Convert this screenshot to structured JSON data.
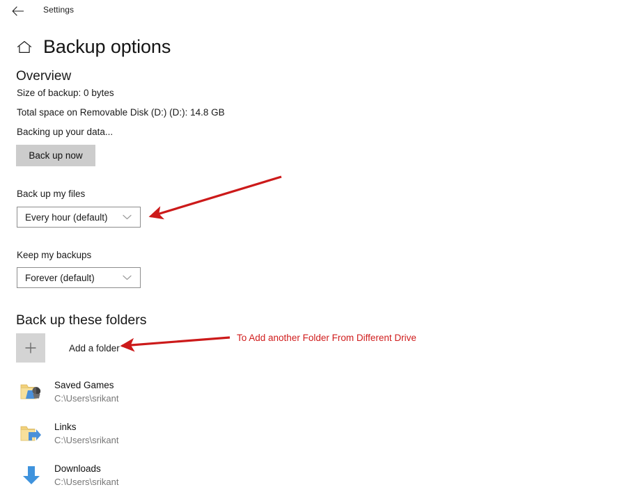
{
  "titlebar": {
    "back_icon": "back-arrow-icon",
    "app_label": "Settings"
  },
  "header": {
    "home_icon": "home-icon",
    "title": "Backup options"
  },
  "overview": {
    "heading": "Overview",
    "size_of_backup": "Size of backup: 0 bytes",
    "total_space": "Total space on Removable Disk (D:) (D:): 14.8 GB",
    "status": "Backing up your data...",
    "backup_now_label": "Back up now",
    "button_color": "#cccccc"
  },
  "settings": {
    "backup_files": {
      "label": "Back up my files",
      "selected": "Every hour (default)",
      "chevron_icon": "chevron-down-icon"
    },
    "keep_backups": {
      "label": "Keep my backups",
      "selected": "Forever (default)",
      "chevron_icon": "chevron-down-icon"
    }
  },
  "folders": {
    "heading": "Back up these folders",
    "add_folder": {
      "label": "Add a folder",
      "icon": "plus-icon",
      "tile_color": "#d4d4d4"
    },
    "items": [
      {
        "name": "Saved Games",
        "path": "C:\\Users\\srikant",
        "icon": "saved-games-folder-icon"
      },
      {
        "name": "Links",
        "path": "C:\\Users\\srikant",
        "icon": "links-shortcut-folder-icon"
      },
      {
        "name": "Downloads",
        "path": "C:\\Users\\srikant",
        "icon": "downloads-arrow-icon"
      }
    ]
  },
  "annotations": {
    "accent_color": "#d01c1c",
    "add_folder_note": "To Add another Folder From Different Drive",
    "arrow_to_dropdown_icon": "red-arrow-icon",
    "arrow_to_add_folder_icon": "red-arrow-icon"
  }
}
